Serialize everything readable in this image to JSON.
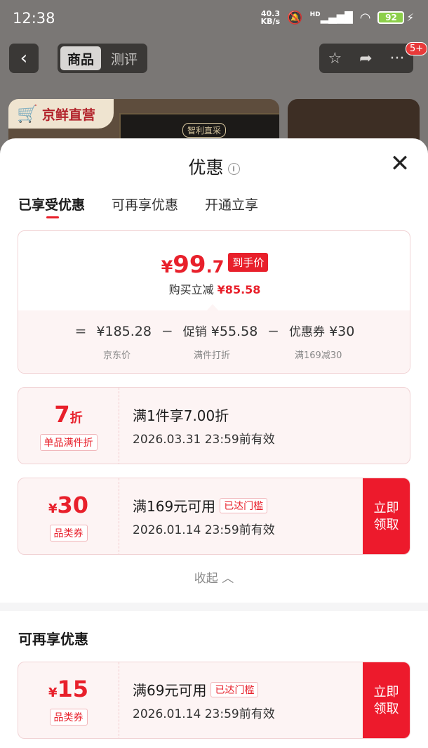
{
  "status": {
    "time": "12:38",
    "net_speed": "40.3",
    "net_unit": "KB/s",
    "hd": "HD",
    "battery": "92"
  },
  "nav": {
    "back": "‹",
    "tab_product": "商品",
    "tab_review": "测评",
    "badge": "5+"
  },
  "banner": {
    "store": "京鲜直营",
    "box_text": "智利直采"
  },
  "sheet": {
    "title": "优惠",
    "tabs": [
      "已享受优惠",
      "可再享优惠",
      "开通立享"
    ],
    "summary": {
      "currency": "¥",
      "price_int": "99",
      "price_dec": ".7",
      "final_label": "到手价",
      "instant_label": "购买立减",
      "instant_amount": "¥85.58",
      "breakdown": {
        "eq": "=",
        "jd_price": "¥185.28",
        "minus1": "−",
        "promo_label": "促销",
        "promo_value": "¥55.58",
        "minus2": "−",
        "coupon_label": "优惠券",
        "coupon_value": "¥30",
        "jd_price_label": "京东价",
        "promo_note": "满件打折",
        "coupon_note": "满169减30"
      }
    },
    "coupons": [
      {
        "amount": "7",
        "unit": "折",
        "tag": "单品满件折",
        "title": "满1件享7.00折",
        "date": "2026.03.31 23:59前有效"
      },
      {
        "currency": "¥",
        "amount": "30",
        "tag": "品类券",
        "title": "满169元可用",
        "threshold": "已达门槛",
        "date": "2026.01.14 23:59前有效",
        "button": "立即\n领取"
      }
    ],
    "collapse": "收起",
    "section2_title": "可再享优惠",
    "more_coupons": [
      {
        "currency": "¥",
        "amount": "15",
        "tag": "品类券",
        "title": "满69元可用",
        "threshold": "已达门槛",
        "date": "2026.01.14 23:59前有效",
        "button": "立即\n领取"
      }
    ]
  }
}
